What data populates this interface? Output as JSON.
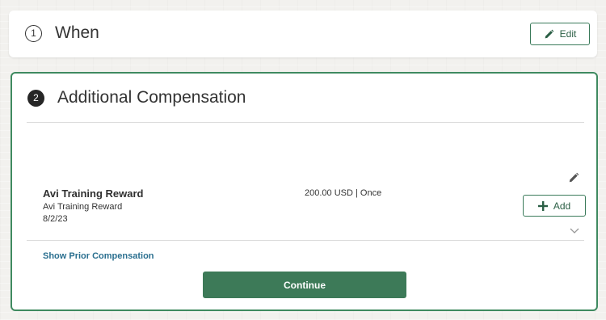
{
  "section_when": {
    "step_number": "1",
    "title": "When",
    "edit_label": "Edit"
  },
  "section_comp": {
    "step_number": "2",
    "title": "Additional Compensation",
    "add_label": "Add",
    "item": {
      "name": "Avi Training Reward",
      "subtitle": "Avi Training Reward",
      "date": "8/2/23",
      "amount": "200.00 USD | Once"
    },
    "prior_link": "Show Prior Compensation",
    "continue_label": "Continue"
  },
  "icons": {
    "edit": "pencil-icon",
    "add": "plus-icon",
    "expand": "chevron-down-icon"
  },
  "colors": {
    "accent": "#3d7a58",
    "link": "#2a6f8f"
  }
}
